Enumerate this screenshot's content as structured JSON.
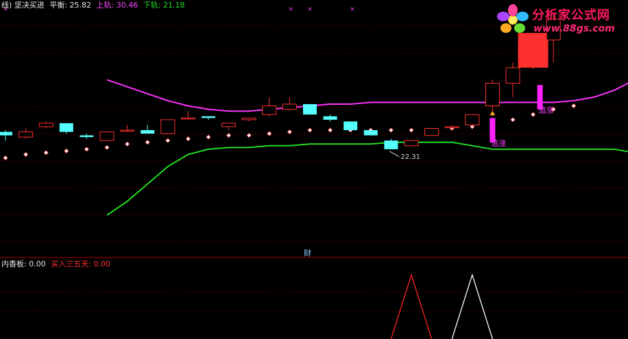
{
  "main_panel": {
    "header": {
      "title": "线) 坚决买进",
      "balance_label": "平衡:",
      "balance_value": "25.82",
      "upper_label": "上轨:",
      "upper_value": "30.46",
      "lower_label": "下轨:",
      "lower_value": "21.18"
    },
    "center_tag": "财"
  },
  "sub_panel": {
    "header": {
      "neixiang_label": "内香板:",
      "neixiang_value": "0.00",
      "buy_label": "买入三五天:",
      "buy_value": "0.00"
    }
  },
  "watermark": {
    "title": "分析家公式网",
    "url": "www.88gs.com"
  },
  "colors": {
    "bull": "#ff3030",
    "bear": "#55ffff",
    "upper_band": "#ff33ff",
    "lower_band": "#22dd22",
    "signal_red": "#ff2222",
    "signal_white": "#ffffff",
    "grid": "#8b0000"
  },
  "chart_data": [
    {
      "type": "candlestick",
      "title": "",
      "ylim": [
        18.8,
        33.6
      ],
      "candles": [
        {
          "o": 26.0,
          "h": 26.1,
          "l": 25.5,
          "c": 25.8
        },
        {
          "o": 25.7,
          "h": 26.2,
          "l": 25.6,
          "c": 26.0
        },
        {
          "o": 26.3,
          "h": 26.6,
          "l": 26.2,
          "c": 26.5
        },
        {
          "o": 26.5,
          "h": 26.5,
          "l": 25.9,
          "c": 26.0
        },
        {
          "o": 25.8,
          "h": 25.9,
          "l": 25.6,
          "c": 25.7
        },
        {
          "o": 25.5,
          "h": 26.0,
          "l": 25.5,
          "c": 26.0
        },
        {
          "o": 26.1,
          "h": 26.4,
          "l": 26.0,
          "c": 26.1
        },
        {
          "o": 26.1,
          "h": 26.4,
          "l": 25.9,
          "c": 25.9
        },
        {
          "o": 25.9,
          "h": 26.7,
          "l": 25.9,
          "c": 26.7
        },
        {
          "o": 26.8,
          "h": 27.2,
          "l": 26.7,
          "c": 26.8
        },
        {
          "o": 26.9,
          "h": 26.9,
          "l": 26.7,
          "c": 26.8
        },
        {
          "o": 26.3,
          "h": 26.5,
          "l": 26.1,
          "c": 26.5
        },
        {
          "o": 26.7,
          "h": 26.8,
          "l": 26.6,
          "c": 26.8
        },
        {
          "o": 27.0,
          "h": 28.0,
          "l": 26.9,
          "c": 27.5
        },
        {
          "o": 27.3,
          "h": 28.0,
          "l": 27.2,
          "c": 27.6
        },
        {
          "o": 27.6,
          "h": 27.6,
          "l": 27.0,
          "c": 27.0
        },
        {
          "o": 26.9,
          "h": 27.0,
          "l": 26.6,
          "c": 26.7
        },
        {
          "o": 26.6,
          "h": 26.6,
          "l": 26.0,
          "c": 26.1
        },
        {
          "o": 26.1,
          "h": 26.1,
          "l": 25.8,
          "c": 25.8
        },
        {
          "o": 25.5,
          "h": 25.6,
          "l": 25.0,
          "c": 25.0
        },
        {
          "o": 25.2,
          "h": 25.5,
          "l": 25.2,
          "c": 25.5
        },
        {
          "o": 25.8,
          "h": 26.2,
          "l": 25.8,
          "c": 26.2
        },
        {
          "o": 26.3,
          "h": 26.4,
          "l": 26.1,
          "c": 26.3
        },
        {
          "o": 26.4,
          "h": 27.0,
          "l": 26.3,
          "c": 27.0
        },
        {
          "o": 27.5,
          "h": 29.0,
          "l": 26.9,
          "c": 28.8
        },
        {
          "o": 28.8,
          "h": 30.0,
          "l": 28.0,
          "c": 29.7
        },
        {
          "o": 29.7,
          "h": 31.7,
          "l": 29.6,
          "c": 31.7
        },
        {
          "o": 31.3,
          "h": 32.8,
          "l": 30.0,
          "c": 32.5
        }
      ],
      "upper_band": [
        29.0,
        28.6,
        28.2,
        27.8,
        27.5,
        27.3,
        27.2,
        27.2,
        27.3,
        27.4,
        27.5,
        27.6,
        27.6,
        27.7,
        27.7,
        27.7,
        27.7,
        27.7,
        27.7,
        27.7,
        27.7,
        27.7,
        27.7,
        27.8,
        28.0,
        28.4,
        29.0,
        30.0,
        30.5
      ],
      "lower_band": [
        21.2,
        22.0,
        23.0,
        24.0,
        24.7,
        25.0,
        25.1,
        25.1,
        25.2,
        25.2,
        25.3,
        25.3,
        25.3,
        25.3,
        25.4,
        25.4,
        25.4,
        25.4,
        25.2,
        25.0,
        25.0,
        25.0,
        25.0,
        25.0,
        25.0,
        25.0,
        24.8,
        24.3,
        24.2
      ],
      "trailing_stop": [
        24.5,
        24.7,
        24.8,
        24.9,
        25.0,
        25.1,
        25.3,
        25.4,
        25.5,
        25.6,
        25.7,
        25.8,
        25.8,
        25.9,
        26.0,
        26.1,
        26.1,
        26.1,
        26.1,
        26.1,
        26.1,
        26.1,
        26.2,
        26.3,
        26.5,
        26.7,
        27.0,
        27.3,
        27.5
      ],
      "price_label": "22.31",
      "chase_label": "追涨",
      "chase_signals": [
        {
          "index": 24,
          "top": 26.8,
          "bottom": 25.4
        },
        {
          "index": 26,
          "top": 28.7,
          "bottom": 27.3
        }
      ]
    },
    {
      "type": "line",
      "title": "",
      "ylim": [
        0,
        1.1
      ],
      "series": [
        {
          "color": "red",
          "points": [
            [
              19.0,
              0
            ],
            [
              20.0,
              1
            ],
            [
              21.0,
              0
            ]
          ]
        },
        {
          "color": "white",
          "points": [
            [
              22.0,
              0
            ],
            [
              23.0,
              1
            ],
            [
              24.0,
              0
            ]
          ]
        }
      ]
    }
  ]
}
